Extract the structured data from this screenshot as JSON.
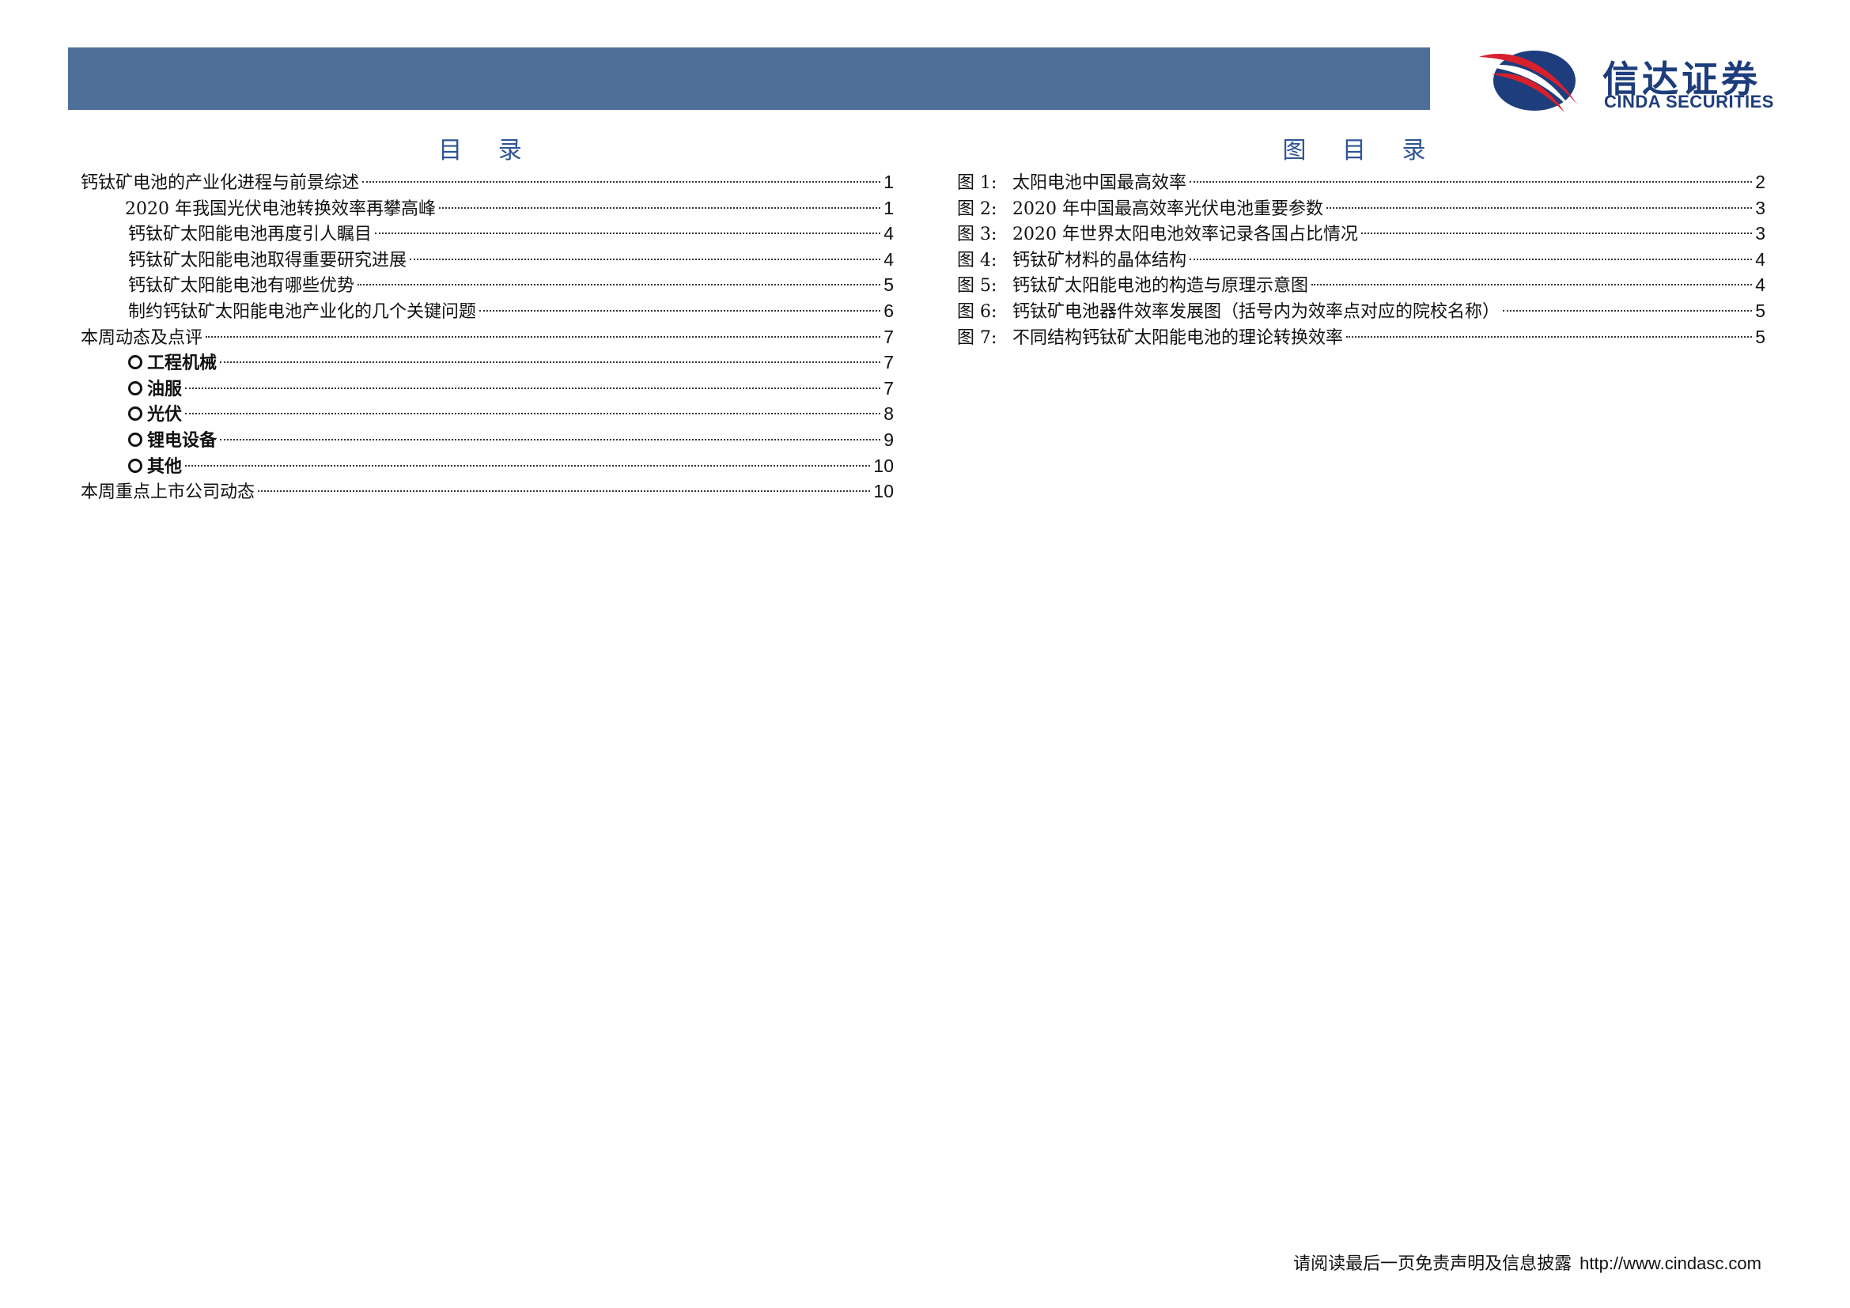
{
  "logo": {
    "name_cn": "信达证券",
    "name_en": "CINDA SECURITIES",
    "icon": "cinda-logo-icon",
    "colors": {
      "red": "#d7202c",
      "blue": "#1d3d7c"
    }
  },
  "header": {
    "bar_color": "#4e6f98"
  },
  "toc": {
    "title": "目 录",
    "items": [
      {
        "text": "钙钛矿电池的产业化进程与前景综述",
        "page": "1"
      },
      {
        "text": "2020 年我国光伏电池转换效率再攀高峰",
        "page": "1"
      },
      {
        "text": "钙钛矿太阳能电池再度引人瞩目",
        "page": "4"
      },
      {
        "text": "钙钛矿太阳能电池取得重要研究进展",
        "page": "4"
      },
      {
        "text": "钙钛矿太阳能电池有哪些优势",
        "page": "5"
      },
      {
        "text": "制约钙钛矿太阳能电池产业化的几个关键问题",
        "page": "6"
      },
      {
        "text": "本周动态及点评",
        "page": "7"
      },
      {
        "text": "工程机械",
        "page": "7"
      },
      {
        "text": "油服",
        "page": "7"
      },
      {
        "text": "光伏",
        "page": "8"
      },
      {
        "text": "锂电设备",
        "page": "9"
      },
      {
        "text": "其他",
        "page": "10"
      },
      {
        "text": "本周重点上市公司动态",
        "page": "10"
      }
    ]
  },
  "figures": {
    "title": "图 目 录",
    "items": [
      {
        "label": "图 1:",
        "text": "太阳电池中国最高效率",
        "page": "2"
      },
      {
        "label": "图 2:",
        "text": "2020 年中国最高效率光伏电池重要参数",
        "page": "3"
      },
      {
        "label": "图 3:",
        "text": "2020 年世界太阳电池效率记录各国占比情况",
        "page": "3"
      },
      {
        "label": "图 4:",
        "text": "钙钛矿材料的晶体结构",
        "page": "4"
      },
      {
        "label": "图 5:",
        "text": "钙钛矿太阳能电池的构造与原理示意图",
        "page": "4"
      },
      {
        "label": "图 6:",
        "text": "钙钛矿电池器件效率发展图（括号内为效率点对应的院校名称）",
        "page": "5"
      },
      {
        "label": "图 7:",
        "text": "不同结构钙钛矿太阳能电池的理论转换效率",
        "page": "5"
      }
    ]
  },
  "footer": {
    "disclaimer": "请阅读最后一页免责声明及信息披露",
    "url": "http://www.cindasc.com"
  }
}
